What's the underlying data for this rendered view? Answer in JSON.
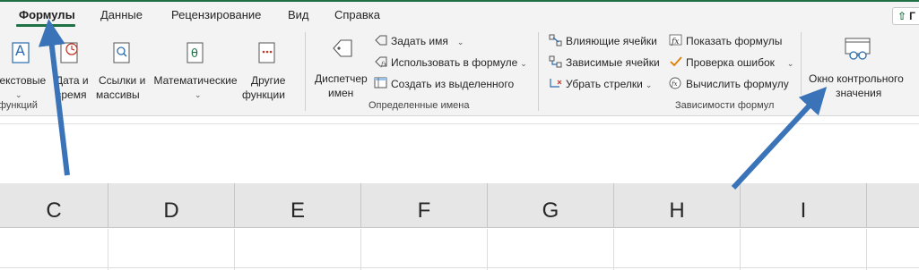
{
  "tabs": [
    {
      "label": "Формулы",
      "active": true
    },
    {
      "label": "Данные"
    },
    {
      "label": "Рецензирование"
    },
    {
      "label": "Вид"
    },
    {
      "label": "Справка"
    }
  ],
  "share_label": "Г",
  "ribbon": {
    "function_library": {
      "text_btn": "Текстовые",
      "date_btn_line1": "Дата и",
      "date_btn_line2": "время",
      "lookup_btn_line1": "Ссылки и",
      "lookup_btn_line2": "массивы",
      "math_btn": "Математические",
      "more_btn_line1": "Другие",
      "more_btn_line2": "функции",
      "group_label": "функций"
    },
    "defined_names": {
      "manager_line1": "Диспетчер",
      "manager_line2": "имен",
      "define_name": "Задать имя",
      "use_in_formula": "Использовать в формуле",
      "create_from_selection": "Создать из выделенного",
      "group_label": "Определенные имена"
    },
    "formula_auditing": {
      "trace_precedents": "Влияющие ячейки",
      "trace_dependents": "Зависимые ячейки",
      "remove_arrows": "Убрать стрелки",
      "show_formulas": "Показать формулы",
      "error_checking": "Проверка ошибок",
      "evaluate_formula": "Вычислить формулу",
      "watch_window_line1": "Окно контрольного",
      "watch_window_line2": "значения",
      "group_label": "Зависимости формул"
    }
  },
  "columns": [
    "C",
    "D",
    "E",
    "F",
    "G",
    "H",
    "I"
  ],
  "colors": {
    "accent_green": "#1e7145",
    "annotation_arrow": "#3a73b8"
  }
}
